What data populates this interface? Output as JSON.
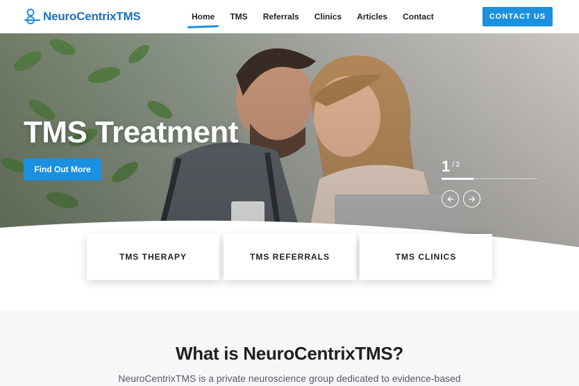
{
  "brand": {
    "name": "NeuroCentrixTMS",
    "color": "#1b6fbd"
  },
  "nav": {
    "items": [
      {
        "label": "Home",
        "active": true
      },
      {
        "label": "TMS",
        "active": false
      },
      {
        "label": "Referrals",
        "active": false
      },
      {
        "label": "Clinics",
        "active": false
      },
      {
        "label": "Articles",
        "active": false
      },
      {
        "label": "Contact",
        "active": false
      }
    ],
    "cta_label": "CONTACT US"
  },
  "hero": {
    "title": "TMS Treatment",
    "button_label": "Find Out More",
    "slide_current": "1",
    "slide_separator": "/",
    "slide_total": "3",
    "progress_fraction": 0.33,
    "image_description_icon": "couple-laughing-photo"
  },
  "cards": [
    {
      "label": "TMS THERAPY"
    },
    {
      "label": "TMS REFERRALS"
    },
    {
      "label": "TMS CLINICS"
    }
  ],
  "about": {
    "title": "What is NeuroCentrixTMS?",
    "text": "NeuroCentrixTMS is a private neuroscience group dedicated to evidence-based"
  },
  "colors": {
    "accent": "#1b8fe0",
    "section_bg": "#f6f7f9"
  }
}
